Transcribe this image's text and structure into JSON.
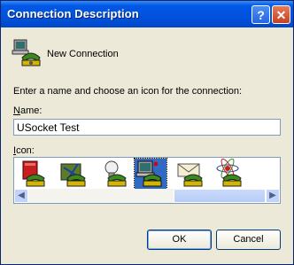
{
  "window": {
    "title": "Connection Description"
  },
  "titlebar": {
    "help_glyph": "?",
    "close_glyph": "✕"
  },
  "connection": {
    "name": "New Connection",
    "icon": "phone-computer-icon"
  },
  "intro_text": "Enter a name and choose an icon for the connection:",
  "name_field": {
    "label": "Name:",
    "value": "USocket Test"
  },
  "icon_field": {
    "label": "Icon:",
    "icons": [
      "book-phone-icon",
      "briefcase-phone-icon",
      "lightbulb-phone-icon",
      "computer-phone-icon",
      "envelope-phone-icon",
      "atom-phone-icon"
    ],
    "selected_index": 3
  },
  "buttons": {
    "ok": "OK",
    "cancel": "Cancel"
  },
  "colors": {
    "title_bar": "#0052de",
    "selection": "#316ac5",
    "dialog_bg": "#ece9d8"
  }
}
